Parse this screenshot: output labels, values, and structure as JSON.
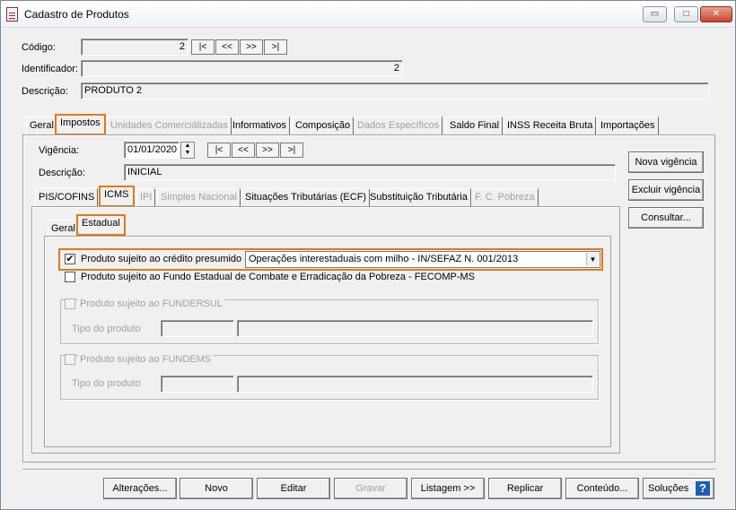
{
  "window": {
    "title": "Cadastro de Produtos",
    "minimize": "▭",
    "maximize": "□",
    "close": "✕"
  },
  "header": {
    "codigo_label": "Código:",
    "codigo_value": "2",
    "identificador_label": "Identificador:",
    "identificador_value": "2",
    "descricao_label": "Descrição:",
    "descricao_value": "PRODUTO 2",
    "nav": [
      "|<",
      "<<",
      ">>",
      ">|"
    ]
  },
  "main_tabs": [
    {
      "label": "Geral",
      "enabled": true
    },
    {
      "label": "Impostos",
      "enabled": true,
      "selected": true
    },
    {
      "label": "Unidades Comerciálizadas",
      "enabled": false
    },
    {
      "label": "Informativos",
      "enabled": true
    },
    {
      "label": "Composição",
      "enabled": true
    },
    {
      "label": "Dados Específicos",
      "enabled": false
    },
    {
      "label": "Saldo Final",
      "enabled": true
    },
    {
      "label": "INSS Receita Bruta",
      "enabled": true
    },
    {
      "label": "Importações",
      "enabled": true
    }
  ],
  "vigencia": {
    "label": "Vigência:",
    "value": "01/01/2020",
    "descricao_label": "Descrição:",
    "descricao_value": "INICIAL",
    "nav": [
      "|<",
      "<<",
      ">>",
      ">|"
    ]
  },
  "side_buttons": [
    "Nova vigência",
    "Excluir vigência",
    "Consultar..."
  ],
  "tax_tabs": [
    {
      "label": "PIS/COFINS",
      "enabled": true
    },
    {
      "label": "ICMS",
      "enabled": true,
      "selected": true
    },
    {
      "label": "IPI",
      "enabled": false
    },
    {
      "label": "Simples Nacional",
      "enabled": false
    },
    {
      "label": "Situações Tributárias (ECF)",
      "enabled": true
    },
    {
      "label": "Substituição Tributária",
      "enabled": true
    },
    {
      "label": "F. C. Pobreza",
      "enabled": false
    }
  ],
  "icms_tabs": [
    {
      "label": "Geral",
      "enabled": true
    },
    {
      "label": "Estadual",
      "enabled": true,
      "selected": true
    }
  ],
  "estadual": {
    "credito_presumido_label": "Produto sujeito ao crédito presumido",
    "credito_presumido_checked": true,
    "credito_presumido_option": "Operações interestaduais com milho - IN/SEFAZ N. 001/2013",
    "fecomp_label": "Produto sujeito ao Fundo Estadual de Combate e Erradicação da Pobreza - FECOMP-MS",
    "fecomp_checked": false,
    "fundersul_label": "Produto sujeito ao FUNDERSUL",
    "fundersul_tipo_label": "Tipo do produto",
    "fundems_label": "Produto sujeito ao FUNDEMS",
    "fundems_tipo_label": "Tipo do produto"
  },
  "footer_buttons": [
    {
      "label": "Alterações...",
      "enabled": true
    },
    {
      "label": "Novo",
      "enabled": true
    },
    {
      "label": "Editar",
      "enabled": true
    },
    {
      "label": "Gravar",
      "enabled": false
    },
    {
      "label": "Listagem >>",
      "enabled": true
    },
    {
      "label": "Replicar",
      "enabled": true
    },
    {
      "label": "Conteúdo...",
      "enabled": true
    },
    {
      "label": "Soluções",
      "enabled": true
    }
  ],
  "help_icon": "?",
  "colors": {
    "highlight": "#e07a16",
    "help": "#1a5fb4"
  }
}
